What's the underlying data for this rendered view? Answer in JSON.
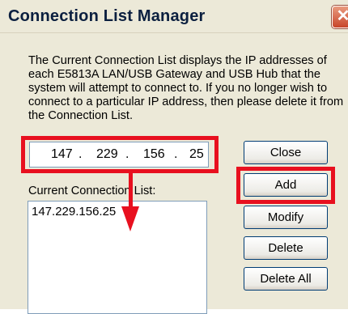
{
  "window": {
    "title": "Connection List Manager",
    "close_glyph": "✕"
  },
  "description": "The Current Connection List displays the IP addresses of each E5813A LAN/USB Gateway and USB Hub that the system will attempt to connect to. If you no longer wish to connect to a particular IP address, then please delete it from the Connection List.",
  "ip_address": {
    "octets": [
      "147",
      "229",
      "156",
      "25"
    ],
    "separator": "."
  },
  "connection_list": {
    "label": "Current Connection List:",
    "items": [
      "147.229.156.25"
    ]
  },
  "buttons": {
    "close": "Close",
    "add": "Add",
    "modify": "Modify",
    "delete": "Delete",
    "delete_all": "Delete All"
  },
  "annotations": {
    "highlight_color": "#e8101f"
  }
}
